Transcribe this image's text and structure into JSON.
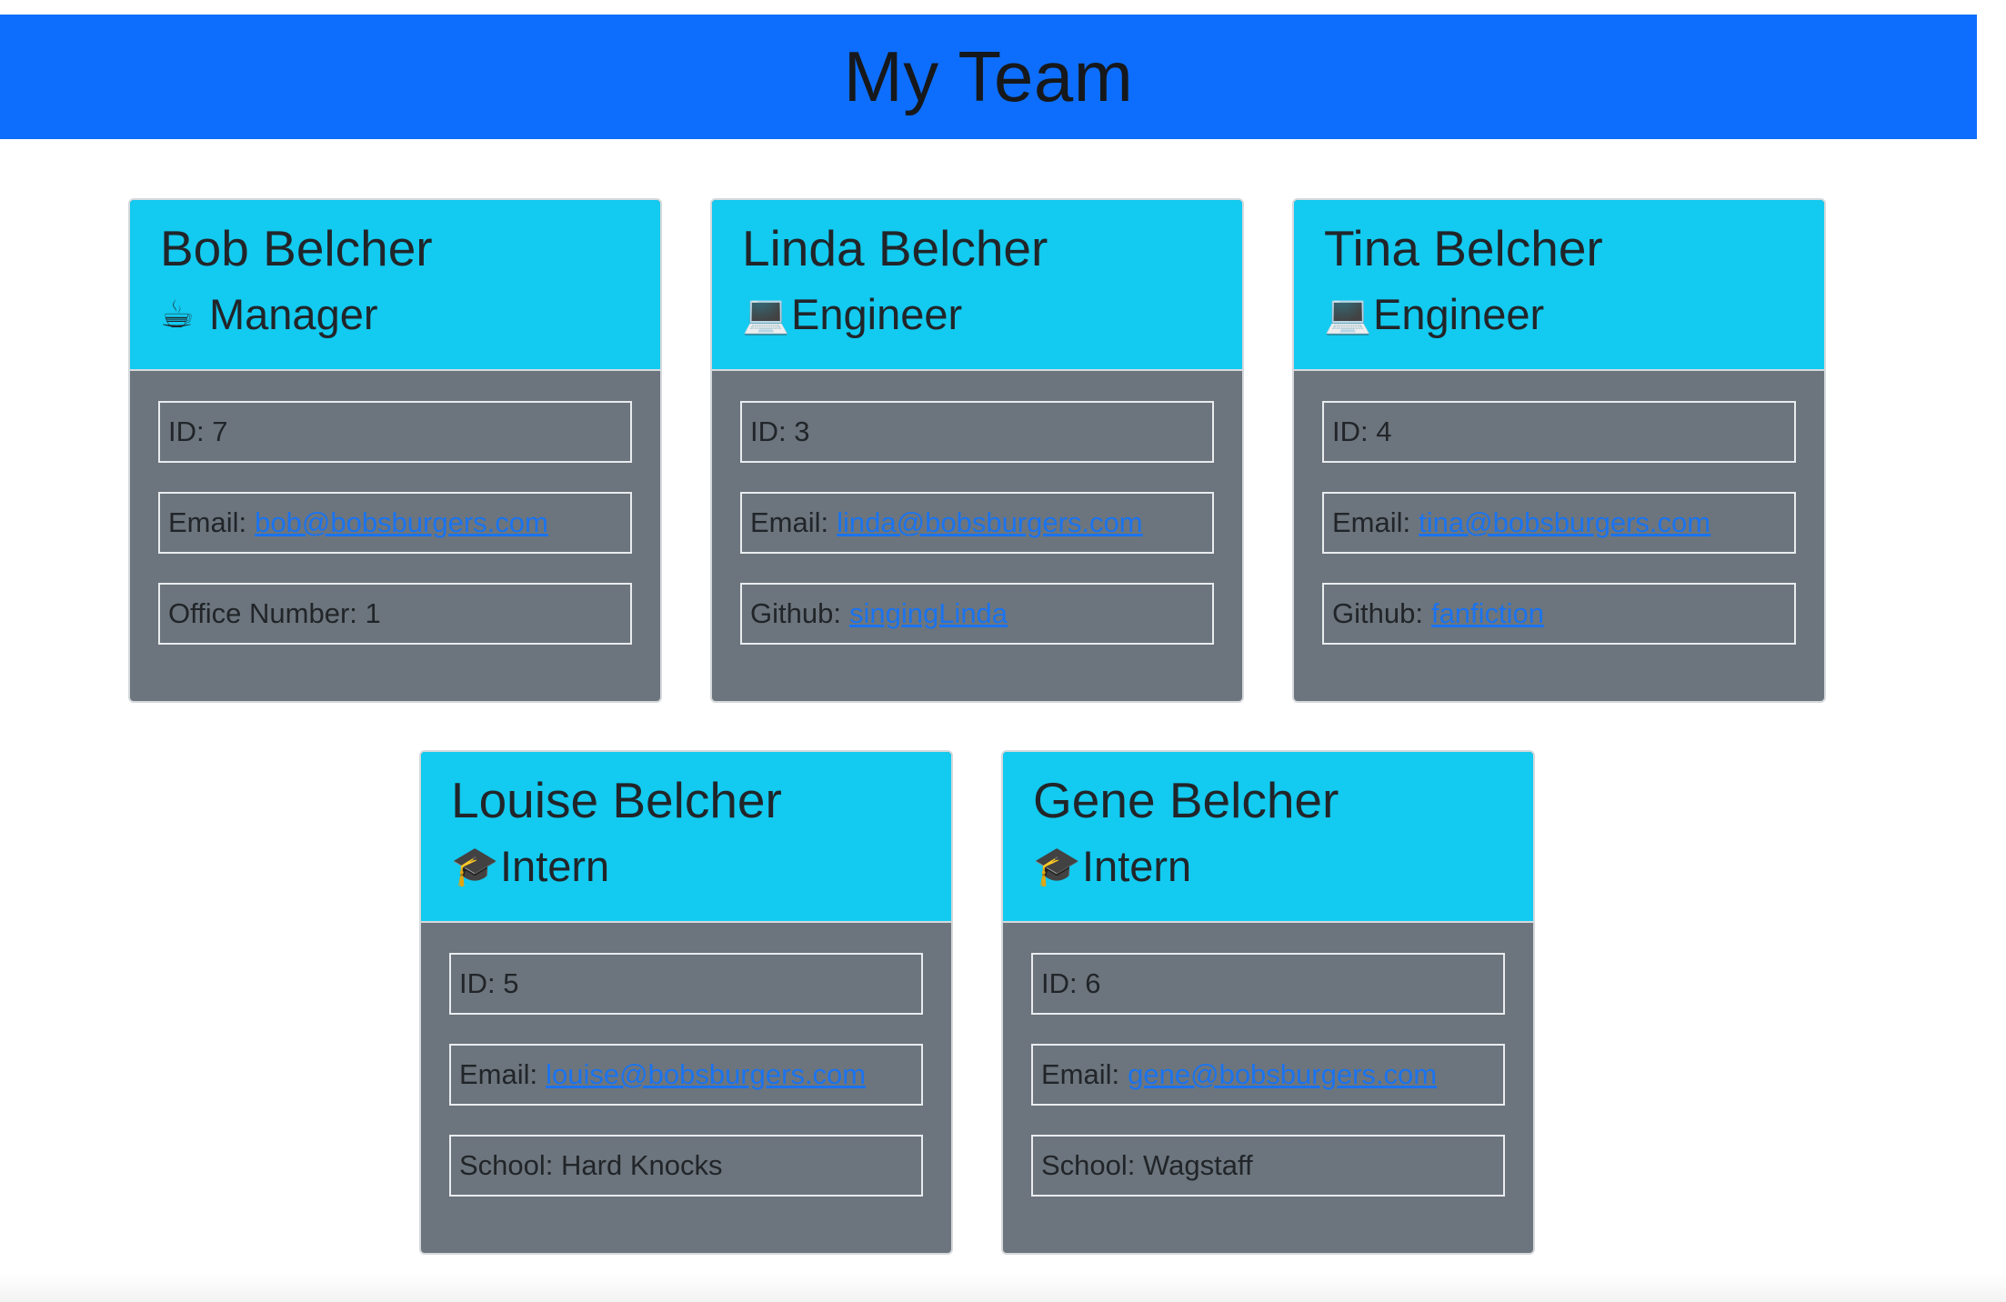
{
  "header": {
    "title": "My Team"
  },
  "team": [
    {
      "name": "Bob Belcher",
      "role": "Manager",
      "icon": "coffee-icon",
      "glyph": "☕",
      "id_label": "ID: 7",
      "email_prefix": "Email:",
      "email": "bob@bobsburgers.com",
      "extra_prefix": "Office Number: 1",
      "extra_link": ""
    },
    {
      "name": "Linda Belcher",
      "role": "Engineer",
      "icon": "laptop-icon",
      "glyph": "💻",
      "id_label": "ID: 3",
      "email_prefix": "Email:",
      "email": "linda@bobsburgers.com",
      "extra_prefix": "Github:",
      "extra_link": "singingLinda"
    },
    {
      "name": "Tina Belcher",
      "role": "Engineer",
      "icon": "laptop-icon",
      "glyph": "💻",
      "id_label": "ID: 4",
      "email_prefix": "Email:",
      "email": "tina@bobsburgers.com",
      "extra_prefix": "Github:",
      "extra_link": "fanfiction"
    },
    {
      "name": "Louise Belcher",
      "role": "Intern",
      "icon": "graduation-cap-icon",
      "glyph": "🎓",
      "id_label": "ID: 5",
      "email_prefix": "Email:",
      "email": "louise@bobsburgers.com",
      "extra_prefix": "School: Hard Knocks",
      "extra_link": ""
    },
    {
      "name": "Gene Belcher",
      "role": "Intern",
      "icon": "graduation-cap-icon",
      "glyph": "🎓",
      "id_label": "ID: 6",
      "email_prefix": "Email:",
      "email": "gene@bobsburgers.com",
      "extra_prefix": "School: Wagstaff",
      "extra_link": ""
    }
  ],
  "colors": {
    "header_bg": "#0d6efd",
    "card_header_bg": "#13caf0",
    "card_body_bg": "#6c757d",
    "link": "#1a73f0"
  }
}
